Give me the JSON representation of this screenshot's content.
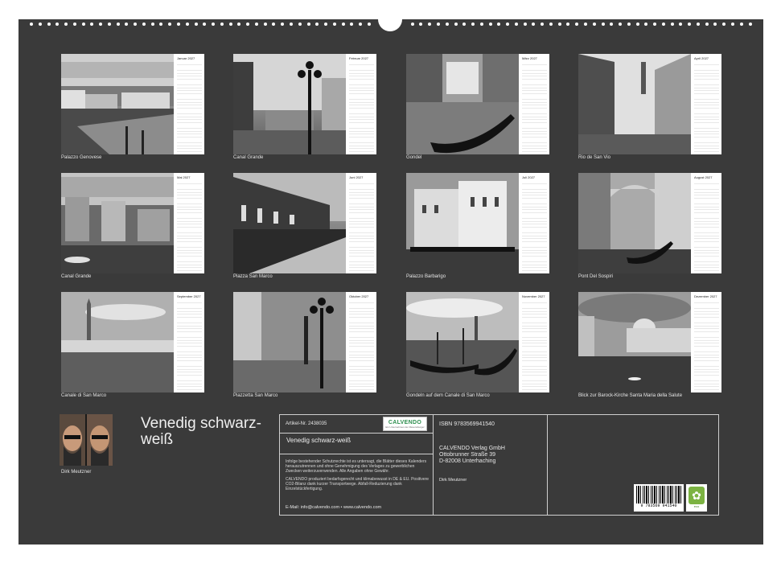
{
  "calendar": {
    "title": "Venedig schwarz-weiß",
    "author": "Dirk Meutzner",
    "months": [
      {
        "month": "Januar 2027",
        "caption": "Palazzo Genovese"
      },
      {
        "month": "Februar 2027",
        "caption": "Canal Grande"
      },
      {
        "month": "März 2027",
        "caption": "Gondel"
      },
      {
        "month": "April 2027",
        "caption": "Rio de San Vio"
      },
      {
        "month": "Mai 2027",
        "caption": "Canal Grande"
      },
      {
        "month": "Juni 2027",
        "caption": "Piazza San Marco"
      },
      {
        "month": "Juli 2027",
        "caption": "Palazzo Barbarigo"
      },
      {
        "month": "August 2027",
        "caption": "Pont Del Sospiri"
      },
      {
        "month": "September 2027",
        "caption": "Canale di San Marco"
      },
      {
        "month": "Oktober 2027",
        "caption": "Piazzetta San Marco"
      },
      {
        "month": "November 2027",
        "caption": "Gondeln auf dem Canale di San Marco"
      },
      {
        "month": "Dezember 2027",
        "caption": "Blick zur Barock-Kirche Santa Maria della Salute"
      }
    ]
  },
  "info": {
    "article": "Artikel-Nr. 2438035",
    "title": "Venedig schwarz-weiß",
    "legal_1": "Infolge bestehender Schutzrechte ist es untersagt, die Blätter dieses Kalenders herauszutrennen und ohne Genehmigung des Verlages zu gewerblichen Zwecken weiterzuverwenden. Alle Angaben ohne Gewähr.",
    "legal_2": "CALVENDO produziert bedarfsgerecht und klimabewusst in DE & EU. Positivere CO2-Bilanz dank kurzer Transportwege. Abfall-Reduzierung dank Einzelstückfertigung.",
    "contact": "E-Mail: info@calvendo.com • www.calvendo.com",
    "isbn": "ISBN 9783569941540",
    "publisher": [
      "CALVENDO Verlag GmbH",
      "Ottobrunner Straße 39",
      "D-82008 Unterhaching"
    ],
    "author_small": "Dirk Meutzner",
    "logo_text": "CALVENDO",
    "logo_sub": "Ein Unternehmen der Ravensburger",
    "barcode_number": "9 783569 941540",
    "eco_label": "eco"
  },
  "colors": {
    "sheet": "#3a3a3a",
    "logo_green": "#2f8f4f",
    "eco_green": "#7cb342"
  }
}
